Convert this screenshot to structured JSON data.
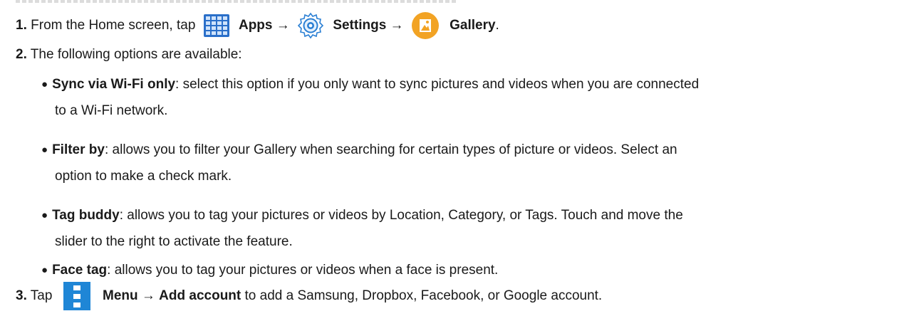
{
  "step1": {
    "number": "1.",
    "text_before": "From the Home screen, tap",
    "apps_label": "Apps",
    "arrow1": "→",
    "settings_label": "Settings",
    "arrow2": "→",
    "gallery_label": "Gallery",
    "period": "."
  },
  "step2": {
    "number": "2.",
    "text": "The following options are available:"
  },
  "options": [
    {
      "title": "Sync via Wi-Fi only",
      "desc_line1": ": select this option if you only want to sync pictures and videos when you are connected",
      "desc_line2": "to a Wi-Fi network."
    },
    {
      "title": "Filter by",
      "desc_line1": ": allows you to filter your Gallery when searching for certain types of picture or videos. Select an",
      "desc_line2": "option to make a check mark."
    },
    {
      "title": "Tag buddy",
      "desc_line1": ": allows you to tag your pictures or videos by Location, Category, or Tags. Touch and move the",
      "desc_line2": "slider to the right to activate the feature."
    },
    {
      "title": "Face tag",
      "desc_line1": ": allows you to tag your pictures or videos when a face is present.",
      "desc_line2": ""
    }
  ],
  "step3": {
    "number": "3.",
    "text_before": "Tap",
    "menu_label": "Menu",
    "arrow": "→",
    "add_account_label": "Add account",
    "text_after": "to add a Samsung, Dropbox, Facebook, or Google account."
  },
  "icons": {
    "apps": "apps-grid-icon",
    "settings": "settings-gear-icon",
    "gallery": "gallery-icon",
    "menu": "menu-icon"
  },
  "colors": {
    "apps_blue": "#2a6fc9",
    "settings_blue": "#2a7fd4",
    "gallery_orange": "#f2a324",
    "menu_blue": "#1f86d6"
  }
}
